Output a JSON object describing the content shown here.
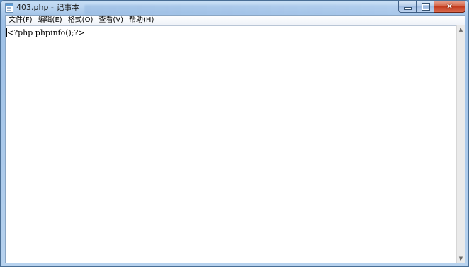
{
  "window": {
    "title": "403.php - 记事本"
  },
  "menubar": {
    "items": [
      {
        "label": "文件(F)"
      },
      {
        "label": "编辑(E)"
      },
      {
        "label": "格式(O)"
      },
      {
        "label": "查看(V)"
      },
      {
        "label": "帮助(H)"
      }
    ]
  },
  "editor": {
    "content": "<?php phpinfo();?>"
  },
  "icons": {
    "app": "notepad-icon",
    "minimize": "minimize-icon",
    "maximize": "maximize-icon",
    "close": "close-icon",
    "scroll_up": "arrow-up-icon",
    "scroll_down": "arrow-down-icon"
  },
  "colors": {
    "close_button": "#c2391c",
    "frame": "#a9c8ea"
  }
}
